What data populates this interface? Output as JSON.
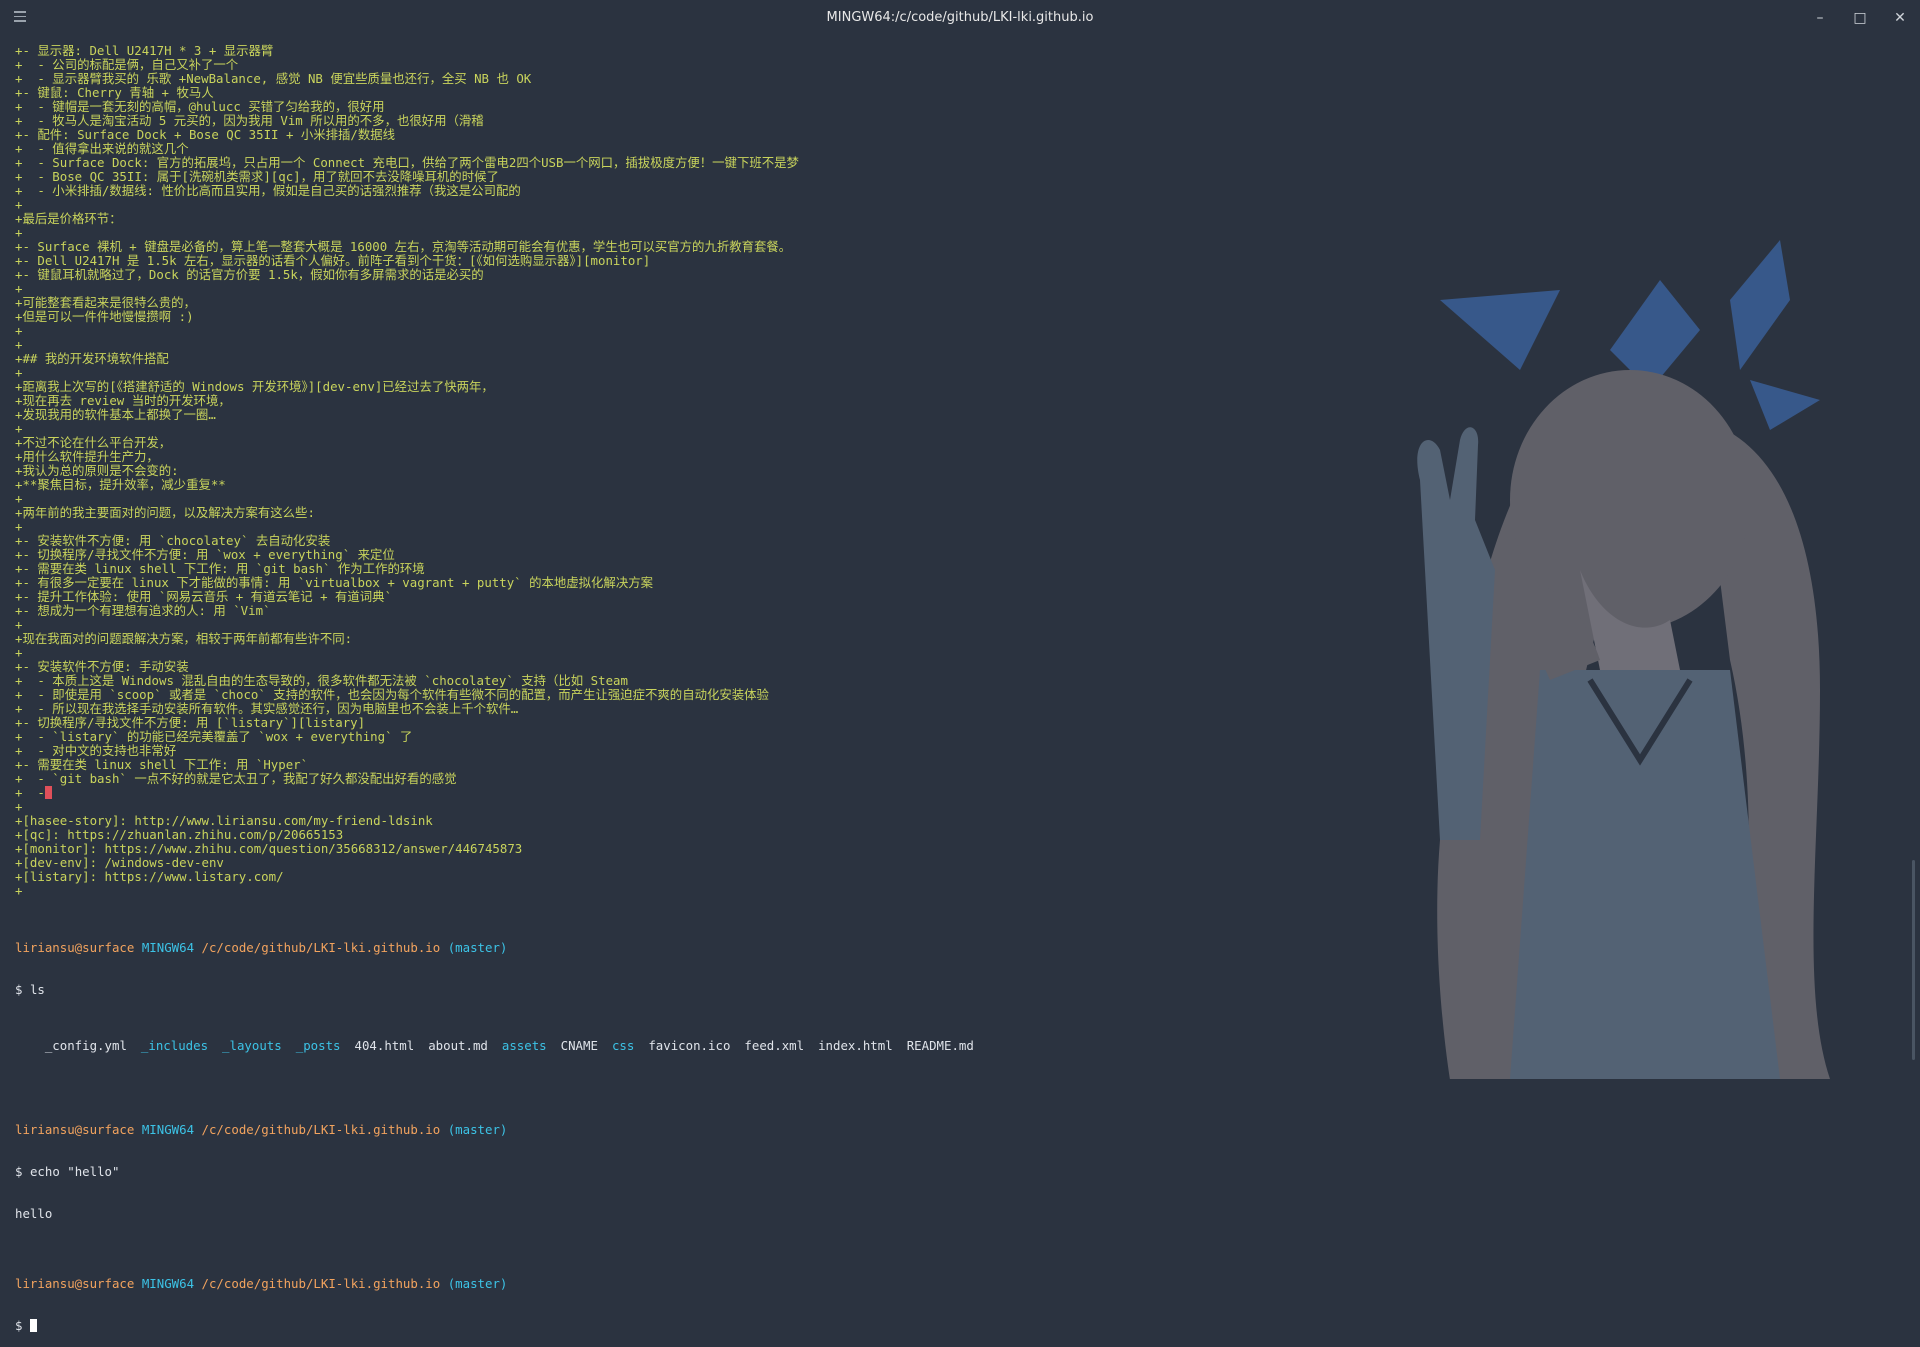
{
  "window": {
    "title": "MINGW64:/c/code/github/LKI-lki.github.io",
    "controls": [
      "minimize",
      "maximize",
      "close"
    ]
  },
  "diff_lines": [
    "+- 显示器: Dell U2417H * 3 + 显示器臂",
    "+  - 公司的标配是俩，自己又补了一个",
    "+  - 显示器臂我买的 乐歌 +NewBalance, 感觉 NB 便宜些质量也还行，全买 NB 也 OK",
    "+- 键鼠: Cherry 青轴 + 牧马人",
    "+  - 键帽是一套无刻的高帽，@hulucc 买错了匀给我的，很好用",
    "+  - 牧马人是淘宝活动 5 元买的，因为我用 Vim 所以用的不多，也很好用（滑稽",
    "+- 配件: Surface Dock + Bose QC 35II + 小米排插/数据线",
    "+  - 值得拿出来说的就这几个",
    "+  - Surface Dock: 官方的拓展坞，只占用一个 Connect 充电口，供给了两个雷电2四个USB一个网口，插拔极度方便！一键下班不是梦",
    "+  - Bose QC 35II: 属于[洗碗机类需求][qc]，用了就回不去没降噪耳机的时候了",
    "+  - 小米排插/数据线: 性价比高而且实用，假如是自己买的话强烈推荐（我这是公司配的",
    "+",
    "+最后是价格环节：",
    "+",
    "+- Surface 裸机 + 键盘是必备的，算上笔一整套大概是 16000 左右，京淘等活动期可能会有优惠，学生也可以买官方的九折教育套餐。",
    "+- Dell U2417H 是 1.5k 左右，显示器的话看个人偏好。前阵子看到个干货：[《如何选购显示器》][monitor]",
    "+- 键鼠耳机就略过了，Dock 的话官方价要 1.5k，假如你有多屏需求的话是必买的",
    "+",
    "+可能整套看起来是很特么贵的，",
    "+但是可以一件件地慢慢攒啊 :)",
    "+",
    "+",
    "+## 我的开发环境软件搭配",
    "+",
    "+距离我上次写的[《搭建舒适的 Windows 开发环境》][dev-env]已经过去了快两年，",
    "+现在再去 review 当时的开发环境，",
    "+发现我用的软件基本上都换了一圈…",
    "+",
    "+不过不论在什么平台开发，",
    "+用什么软件提升生产力，",
    "+我认为总的原则是不会变的:",
    "+**聚焦目标，提升效率，减少重复**",
    "+",
    "+两年前的我主要面对的问题，以及解决方案有这么些:",
    "+",
    "+- 安装软件不方便: 用 `chocolatey` 去自动化安装",
    "+- 切换程序/寻找文件不方便: 用 `wox + everything` 来定位",
    "+- 需要在类 linux shell 下工作: 用 `git bash` 作为工作的环境",
    "+- 有很多一定要在 linux 下才能做的事情: 用 `virtualbox + vagrant + putty` 的本地虚拟化解决方案",
    "+- 提升工作体验: 使用 `网易云音乐 + 有道云笔记 + 有道词典`",
    "+- 想成为一个有理想有追求的人: 用 `Vim`",
    "+",
    "+现在我面对的问题跟解决方案，相较于两年前都有些许不同:",
    "+",
    "+- 安装软件不方便: 手动安装",
    "+  - 本质上这是 Windows 混乱自由的生态导致的，很多软件都无法被 `chocolatey` 支持（比如 Steam",
    "+  - 即使是用 `scoop` 或者是 `choco` 支持的软件，也会因为每个软件有些微不同的配置，而产生让强迫症不爽的自动化安装体验",
    "+  - 所以现在我选择手动安装所有软件。其实感觉还行，因为电脑里也不会装上千个软件…",
    "+- 切换程序/寻找文件不方便: 用 [`listary`][listary]",
    "+  - `listary` 的功能已经完美覆盖了 `wox + everything` 了",
    "+  - 对中文的支持也非常好",
    "+- 需要在类 linux shell 下工作: 用 `Hyper`",
    "+  - `git bash` 一点不好的就是它太丑了，我配了好久都没配出好看的感觉",
    "+  -",
    "+",
    "+[hasee-story]: http://www.liriansu.com/my-friend-ldsink",
    "+[qc]: https://zhuanlan.zhihu.com/p/20665153",
    "+[monitor]: https://www.zhihu.com/question/35668312/answer/446745873",
    "+[dev-env]: /windows-dev-env",
    "+[listary]: https://www.listary.com/",
    "+"
  ],
  "prompt": {
    "user": "liriansu@surface",
    "host": "MINGW64",
    "path": "/c/code/github/LKI-lki.github.io",
    "branch": "(master)",
    "symbol": "$"
  },
  "commands": {
    "ls": "ls",
    "echo": "echo \"hello\"",
    "echo_output": "hello"
  },
  "ls_output": {
    "files": [
      "_config.yml",
      "404.html",
      "about.md",
      "CNAME",
      "favicon.ico",
      "feed.xml",
      "index.html",
      "README.md"
    ],
    "dirs": [
      "_includes",
      "_layouts",
      "_posts",
      "assets",
      "css"
    ]
  },
  "colors": {
    "background": "#2b3340",
    "diff_text": "#c9d45c",
    "user": "#f2a35e",
    "host": "#3cc3e6",
    "art_hair": "#6a6870",
    "art_ribbon": "#3a5f97"
  }
}
